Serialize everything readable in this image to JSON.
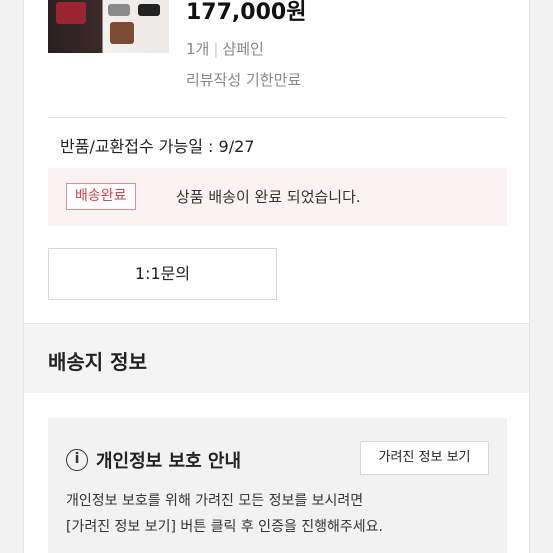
{
  "product": {
    "price": "177,000원",
    "quantity": "1개",
    "option": "샴페인",
    "review_status": "리뷰작성 기한만료"
  },
  "return_info": "반품/교환접수 가능일 : 9/27",
  "delivery": {
    "badge": "배송완료",
    "message": "상품 배송이 완료 되었습니다."
  },
  "inquiry_button": "1:1문의",
  "shipping_section": {
    "title": "배송지 정보"
  },
  "privacy": {
    "icon": "info-icon",
    "title": "개인정보 보호 안내",
    "view_button": "가려진 정보 보기",
    "desc_line1": "개인정보 보호를 위해 가려진 모든 정보를 보시려면",
    "desc_line2": "[가려진 정보 보기] 버튼 클릭 후 인증을 진행해주세요."
  },
  "colors": {
    "badge_text": "#d4434b",
    "badge_border": "#e08e92",
    "status_bg": "#fbf3f3",
    "section_bg": "#f4f4f4"
  }
}
